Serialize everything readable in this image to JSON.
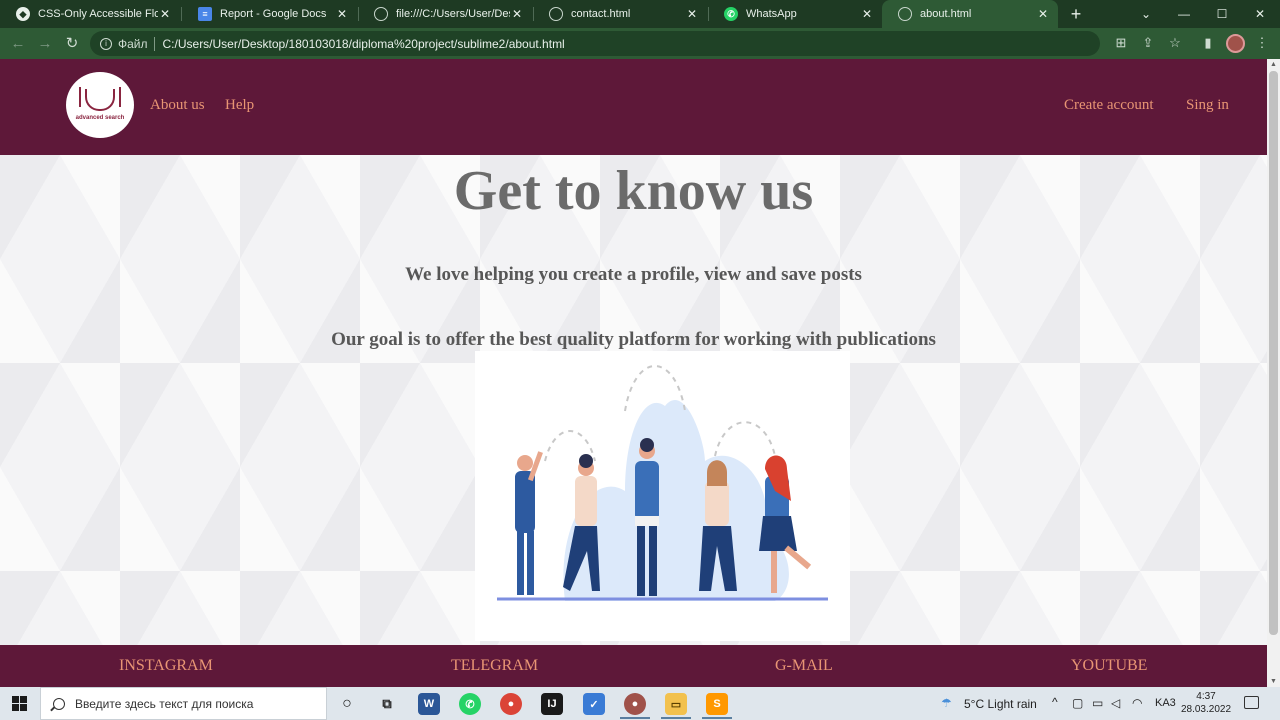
{
  "browser": {
    "tabs": [
      {
        "title": "CSS-Only Accessible Floatin",
        "icon": "codepen-icon"
      },
      {
        "title": "Report - Google Docs",
        "icon": "docs-icon"
      },
      {
        "title": "file:///C:/Users/User/Deskto",
        "icon": "globe-icon"
      },
      {
        "title": "contact.html",
        "icon": "globe-icon"
      },
      {
        "title": "WhatsApp",
        "icon": "whatsapp-icon"
      },
      {
        "title": "about.html",
        "icon": "globe-icon",
        "active": true
      }
    ],
    "address": {
      "scheme_label": "Файл",
      "url": "C:/Users/User/Desktop/180103018/diploma%20project/sublime2/about.html"
    }
  },
  "site": {
    "logo_text": "advanced search",
    "nav_left": [
      "About us",
      "Help"
    ],
    "nav_right": [
      "Create account",
      "Sing in"
    ],
    "title": "Get to know us",
    "tagline_1": "We love helping you create a profile, view and save posts",
    "tagline_2": "Our goal is to offer the best quality platform for working with publications",
    "footer_links": [
      "INSTAGRAM",
      "TELEGRAM",
      "G-MAIL",
      "YOUTUBE"
    ],
    "colors": {
      "brand": "#5e1839",
      "link": "#e89574",
      "heading": "#6b6b6b"
    }
  },
  "taskbar": {
    "search_placeholder": "Введите здесь текст для поиска",
    "weather": "5°C  Light rain",
    "language": "KA3",
    "time": "4:37",
    "date": "28.03.2022"
  }
}
